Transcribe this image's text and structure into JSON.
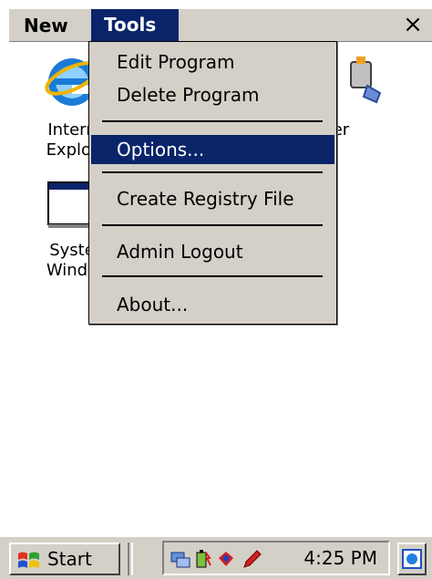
{
  "menubar": {
    "new_label": "New",
    "tools_label": "Tools",
    "close_label": "×"
  },
  "desktop": {
    "icons": [
      {
        "label_line1": "Intern",
        "label_line2": "Explor",
        "icon": "internet-explorer-icon"
      },
      {
        "label_line1": "Syste",
        "label_line2": "Windo",
        "icon": "window-icon"
      },
      {
        "label_line1": "wer",
        "label_line2": "",
        "icon": "power-icon"
      }
    ]
  },
  "tools_menu": {
    "items": [
      {
        "label": "Edit Program"
      },
      {
        "label": "Delete Program"
      },
      {
        "label": "Options..."
      },
      {
        "label": "Create Registry File"
      },
      {
        "label": "Admin Logout"
      },
      {
        "label": "About..."
      }
    ],
    "selected": "Options..."
  },
  "taskbar": {
    "start_label": "Start",
    "clock": "4:25 PM",
    "tray_icons": [
      "network-icon",
      "battery-icon",
      "connection-icon",
      "pen-icon"
    ]
  },
  "colors": {
    "highlight": "#0a246a",
    "chrome": "#d4d0c8"
  }
}
